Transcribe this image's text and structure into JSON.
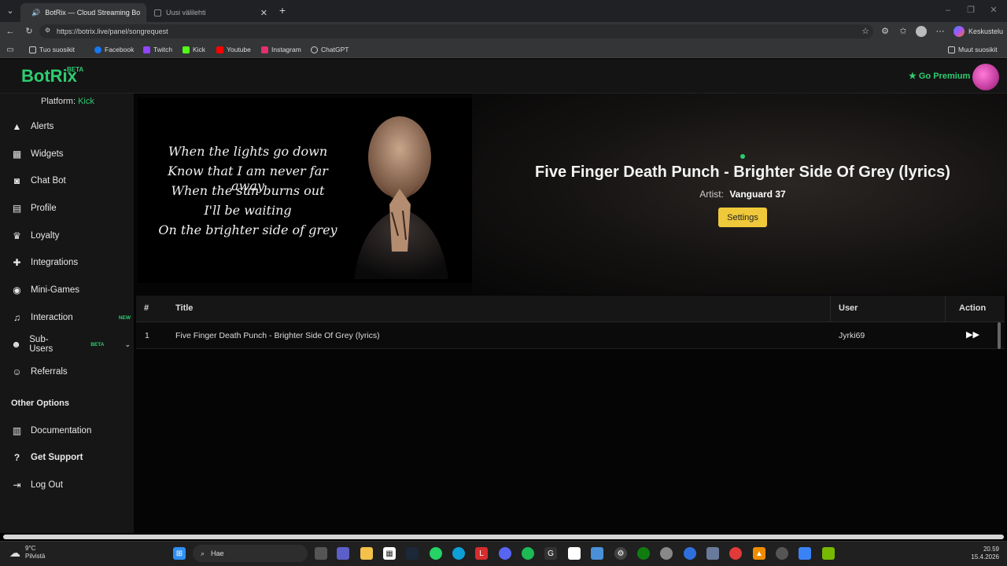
{
  "browser": {
    "tabs": [
      {
        "label": "BotRix — Cloud Streaming Bo",
        "active": true
      },
      {
        "label": "Uusi välilehti",
        "active": false
      }
    ],
    "url": "https://botrix.live/panel/songrequest",
    "profile_label": "Keskustelu",
    "bookmarks": [
      {
        "label": "Tuo suosikit",
        "icon": "import-icon",
        "color": "#cfcfcf"
      },
      {
        "label": "Facebook",
        "icon": "facebook-icon",
        "color": "#1877f2"
      },
      {
        "label": "Twitch",
        "icon": "twitch-icon",
        "color": "#9146ff"
      },
      {
        "label": "Kick",
        "icon": "kick-icon",
        "color": "#53fc18"
      },
      {
        "label": "Youtube",
        "icon": "youtube-icon",
        "color": "#ff0000"
      },
      {
        "label": "Instagram",
        "icon": "instagram-icon",
        "color": "#e1306c"
      },
      {
        "label": "ChatGPT",
        "icon": "chatgpt-icon",
        "color": "#cfcfcf"
      }
    ],
    "other_bookmarks": "Muut suosikit"
  },
  "app": {
    "logo": "BotRix",
    "logo_badge": "BETA",
    "premium_label": "Go Premium",
    "accent": "#2ecc71"
  },
  "sidebar": {
    "platform_label": "Platform:",
    "platform_value": "Kick",
    "items": [
      {
        "label": "Alerts",
        "icon": "warning-icon"
      },
      {
        "label": "Widgets",
        "icon": "grid-icon"
      },
      {
        "label": "Chat Bot",
        "icon": "robot-icon"
      },
      {
        "label": "Profile",
        "icon": "id-card-icon"
      },
      {
        "label": "Loyalty",
        "icon": "trophy-icon"
      },
      {
        "label": "Integrations",
        "icon": "puzzle-icon"
      },
      {
        "label": "Mini-Games",
        "icon": "gamepad-icon"
      },
      {
        "label": "Interaction",
        "icon": "music-icon",
        "badge": "NEW"
      },
      {
        "label": "Sub-Users",
        "icon": "users-icon",
        "badge": "BETA"
      },
      {
        "label": "Referrals",
        "icon": "user-group-icon"
      }
    ],
    "other_options_title": "Other Options",
    "other_items": [
      {
        "label": "Documentation",
        "icon": "book-icon"
      },
      {
        "label": "Get Support",
        "icon": "question-icon"
      },
      {
        "label": "Log Out",
        "icon": "logout-icon"
      }
    ]
  },
  "player": {
    "lyrics": [
      "When the lights go down",
      "Know that I am never far away",
      "When the sun burns out",
      "I'll be waiting",
      "On the brighter side of grey"
    ],
    "title": "Five Finger Death Punch - Brighter Side Of Grey (lyrics)",
    "artist_label": "Artist:",
    "artist_value": "Vanguard 37",
    "settings_label": "Settings"
  },
  "queue": {
    "headers": {
      "num": "#",
      "title": "Title",
      "user": "User",
      "action": "Action"
    },
    "rows": [
      {
        "num": "1",
        "title": "Five Finger Death Punch - Brighter Side Of Grey (lyrics)",
        "user": "Jyrki69",
        "action_icon": "skip-forward-icon"
      }
    ]
  },
  "taskbar": {
    "weather_temp": "9°C",
    "weather_desc": "Pilvistä",
    "search_placeholder": "Hae",
    "time": "20.59",
    "date": "15.4.2026"
  }
}
